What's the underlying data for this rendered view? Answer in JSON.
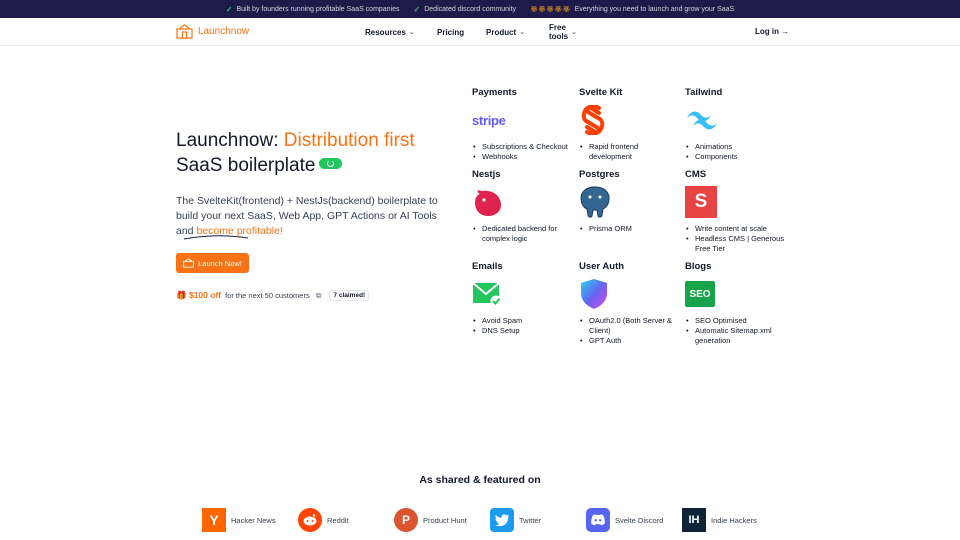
{
  "announcement": {
    "item1": "Built by founders running profitable SaaS companies",
    "item2": "Dedicated discord community",
    "item3": "Everything you need to launch and grow your SaaS"
  },
  "header": {
    "brand": "Launchnow",
    "nav": [
      "Resources",
      "Pricing",
      "Product",
      "Free tools"
    ],
    "login": "Log in →"
  },
  "hero": {
    "title_prefix": "Launchnow: ",
    "title_accent": "Distribution first",
    "title_line2": "SaaS boilerplate",
    "desc_main": "The SvelteKit(frontend) + NestJs(backend) boilerplate to build your next SaaS, Web App, GPT Actions or AI Tools and ",
    "desc_accent": "become profitable!",
    "cta": "Launch Now!",
    "offer_amount": "$100 off",
    "offer_text": "for the next 50 customers",
    "offer_claimed": "7 claimed!"
  },
  "tech": [
    {
      "title": "Payments",
      "icon": "stripe-icon",
      "items": [
        "Subscriptions & Checkout",
        "Webhooks"
      ]
    },
    {
      "title": "Svelte Kit",
      "icon": "svelte-icon",
      "items": [
        "Rapid frontend development"
      ]
    },
    {
      "title": "Tailwind",
      "icon": "tailwind-icon",
      "items": [
        "Animations",
        "Components"
      ]
    },
    {
      "title": "Nestjs",
      "icon": "nestjs-icon",
      "items": [
        "Dedicated backend for complex logic"
      ]
    },
    {
      "title": "Postgres",
      "icon": "postgres-icon",
      "items": [
        "Prisma ORM"
      ]
    },
    {
      "title": "CMS",
      "icon": "cms-icon",
      "items": [
        "Write content at scale",
        "Headless CMS | Generous Free Tier"
      ]
    },
    {
      "title": "Emails",
      "icon": "email-icon",
      "items": [
        "Avoid Spam",
        "DNS Setup"
      ]
    },
    {
      "title": "User Auth",
      "icon": "shield-icon",
      "items": [
        "OAuth2.0 (Both Server & Client)",
        "GPT Auth"
      ]
    },
    {
      "title": "Blogs",
      "icon": "seo-icon",
      "items": [
        "SEO Optimised",
        "Automatic Sitemap.xml generation"
      ]
    }
  ],
  "icons": {
    "stripe": "stripe",
    "cms": "S",
    "seo": "SEO"
  },
  "featured": {
    "title": "As shared & featured on",
    "items": [
      {
        "label": "Hacker News",
        "glyph": "Y",
        "color": "#ff6600"
      },
      {
        "label": "Reddit",
        "glyph": "",
        "color": "#ff4500"
      },
      {
        "label": "Product Hunt",
        "glyph": "P",
        "color": "#da552f"
      },
      {
        "label": "Twitter",
        "glyph": "",
        "color": "#1d9bf0"
      },
      {
        "label": "Svelte Discord",
        "glyph": "",
        "color": "#5865f2"
      },
      {
        "label": "Indie Hackers",
        "glyph": "IH",
        "color": "#0e2439"
      }
    ]
  },
  "colors": {
    "accent": "#f97316",
    "topbar": "#1e1b4b",
    "success": "#22c55e"
  }
}
